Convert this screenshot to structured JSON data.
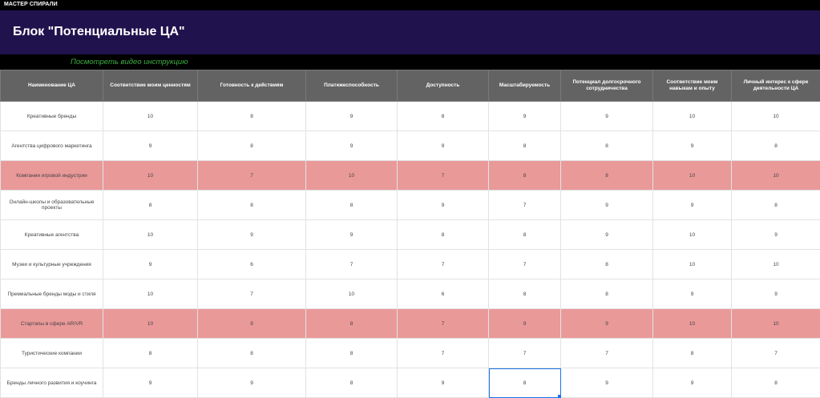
{
  "app": {
    "sheet_label": "МАСТЕР СПИРАЛИ"
  },
  "banner": {
    "title": "Блок \"Потенциальные ЦА\""
  },
  "video_link": "Посмотреть видео инструкцию",
  "colors": {
    "banner_bg": "#20124d",
    "header_bg": "#636363",
    "highlight": "#ea9999",
    "link": "#3cb043",
    "selection": "#1a73e8"
  },
  "table": {
    "headers": [
      "Наименование ЦА",
      "Соответствие моим ценностям",
      "Готовность к действиям",
      "Платежеспособность",
      "Доступность",
      "Масштабируемость",
      "Потенциал долгосрочного сотрудничества",
      "Соответствие моим навыкам и опыту",
      "Личный интерес к сфере деятельности ЦА"
    ],
    "rows": [
      {
        "cells": [
          "Креативные бренды",
          "10",
          "8",
          "9",
          "8",
          "9",
          "9",
          "10",
          "10"
        ],
        "highlight": false
      },
      {
        "cells": [
          "Агентства цифрового маркетинга",
          "9",
          "8",
          "9",
          "9",
          "8",
          "8",
          "9",
          "8"
        ],
        "highlight": false
      },
      {
        "cells": [
          "Компании игровой индустрии",
          "10",
          "7",
          "10",
          "7",
          "8",
          "8",
          "10",
          "10"
        ],
        "highlight": true
      },
      {
        "cells": [
          "Онлайн-школы и образовательные проекты",
          "8",
          "8",
          "8",
          "9",
          "7",
          "9",
          "9",
          "8"
        ],
        "highlight": false
      },
      {
        "cells": [
          "Креативные агентства",
          "10",
          "9",
          "9",
          "8",
          "8",
          "9",
          "10",
          "9"
        ],
        "highlight": false
      },
      {
        "cells": [
          "Музеи и культурные учреждения",
          "9",
          "6",
          "7",
          "7",
          "7",
          "8",
          "10",
          "10"
        ],
        "highlight": false
      },
      {
        "cells": [
          "Премиальные бренды моды и стиля",
          "10",
          "7",
          "10",
          "6",
          "8",
          "8",
          "9",
          "9"
        ],
        "highlight": false
      },
      {
        "cells": [
          "Стартапы в сфере AR/VR",
          "10",
          "9",
          "8",
          "7",
          "9",
          "9",
          "10",
          "10"
        ],
        "highlight": true
      },
      {
        "cells": [
          "Туристические компании",
          "8",
          "8",
          "8",
          "7",
          "7",
          "7",
          "8",
          "7"
        ],
        "highlight": false
      },
      {
        "cells": [
          "Бренды личного развития и коучинга",
          "9",
          "9",
          "8",
          "9",
          "8",
          "9",
          "9",
          "8"
        ],
        "highlight": false
      }
    ],
    "selected_cell": {
      "row": 9,
      "col": 5
    }
  }
}
